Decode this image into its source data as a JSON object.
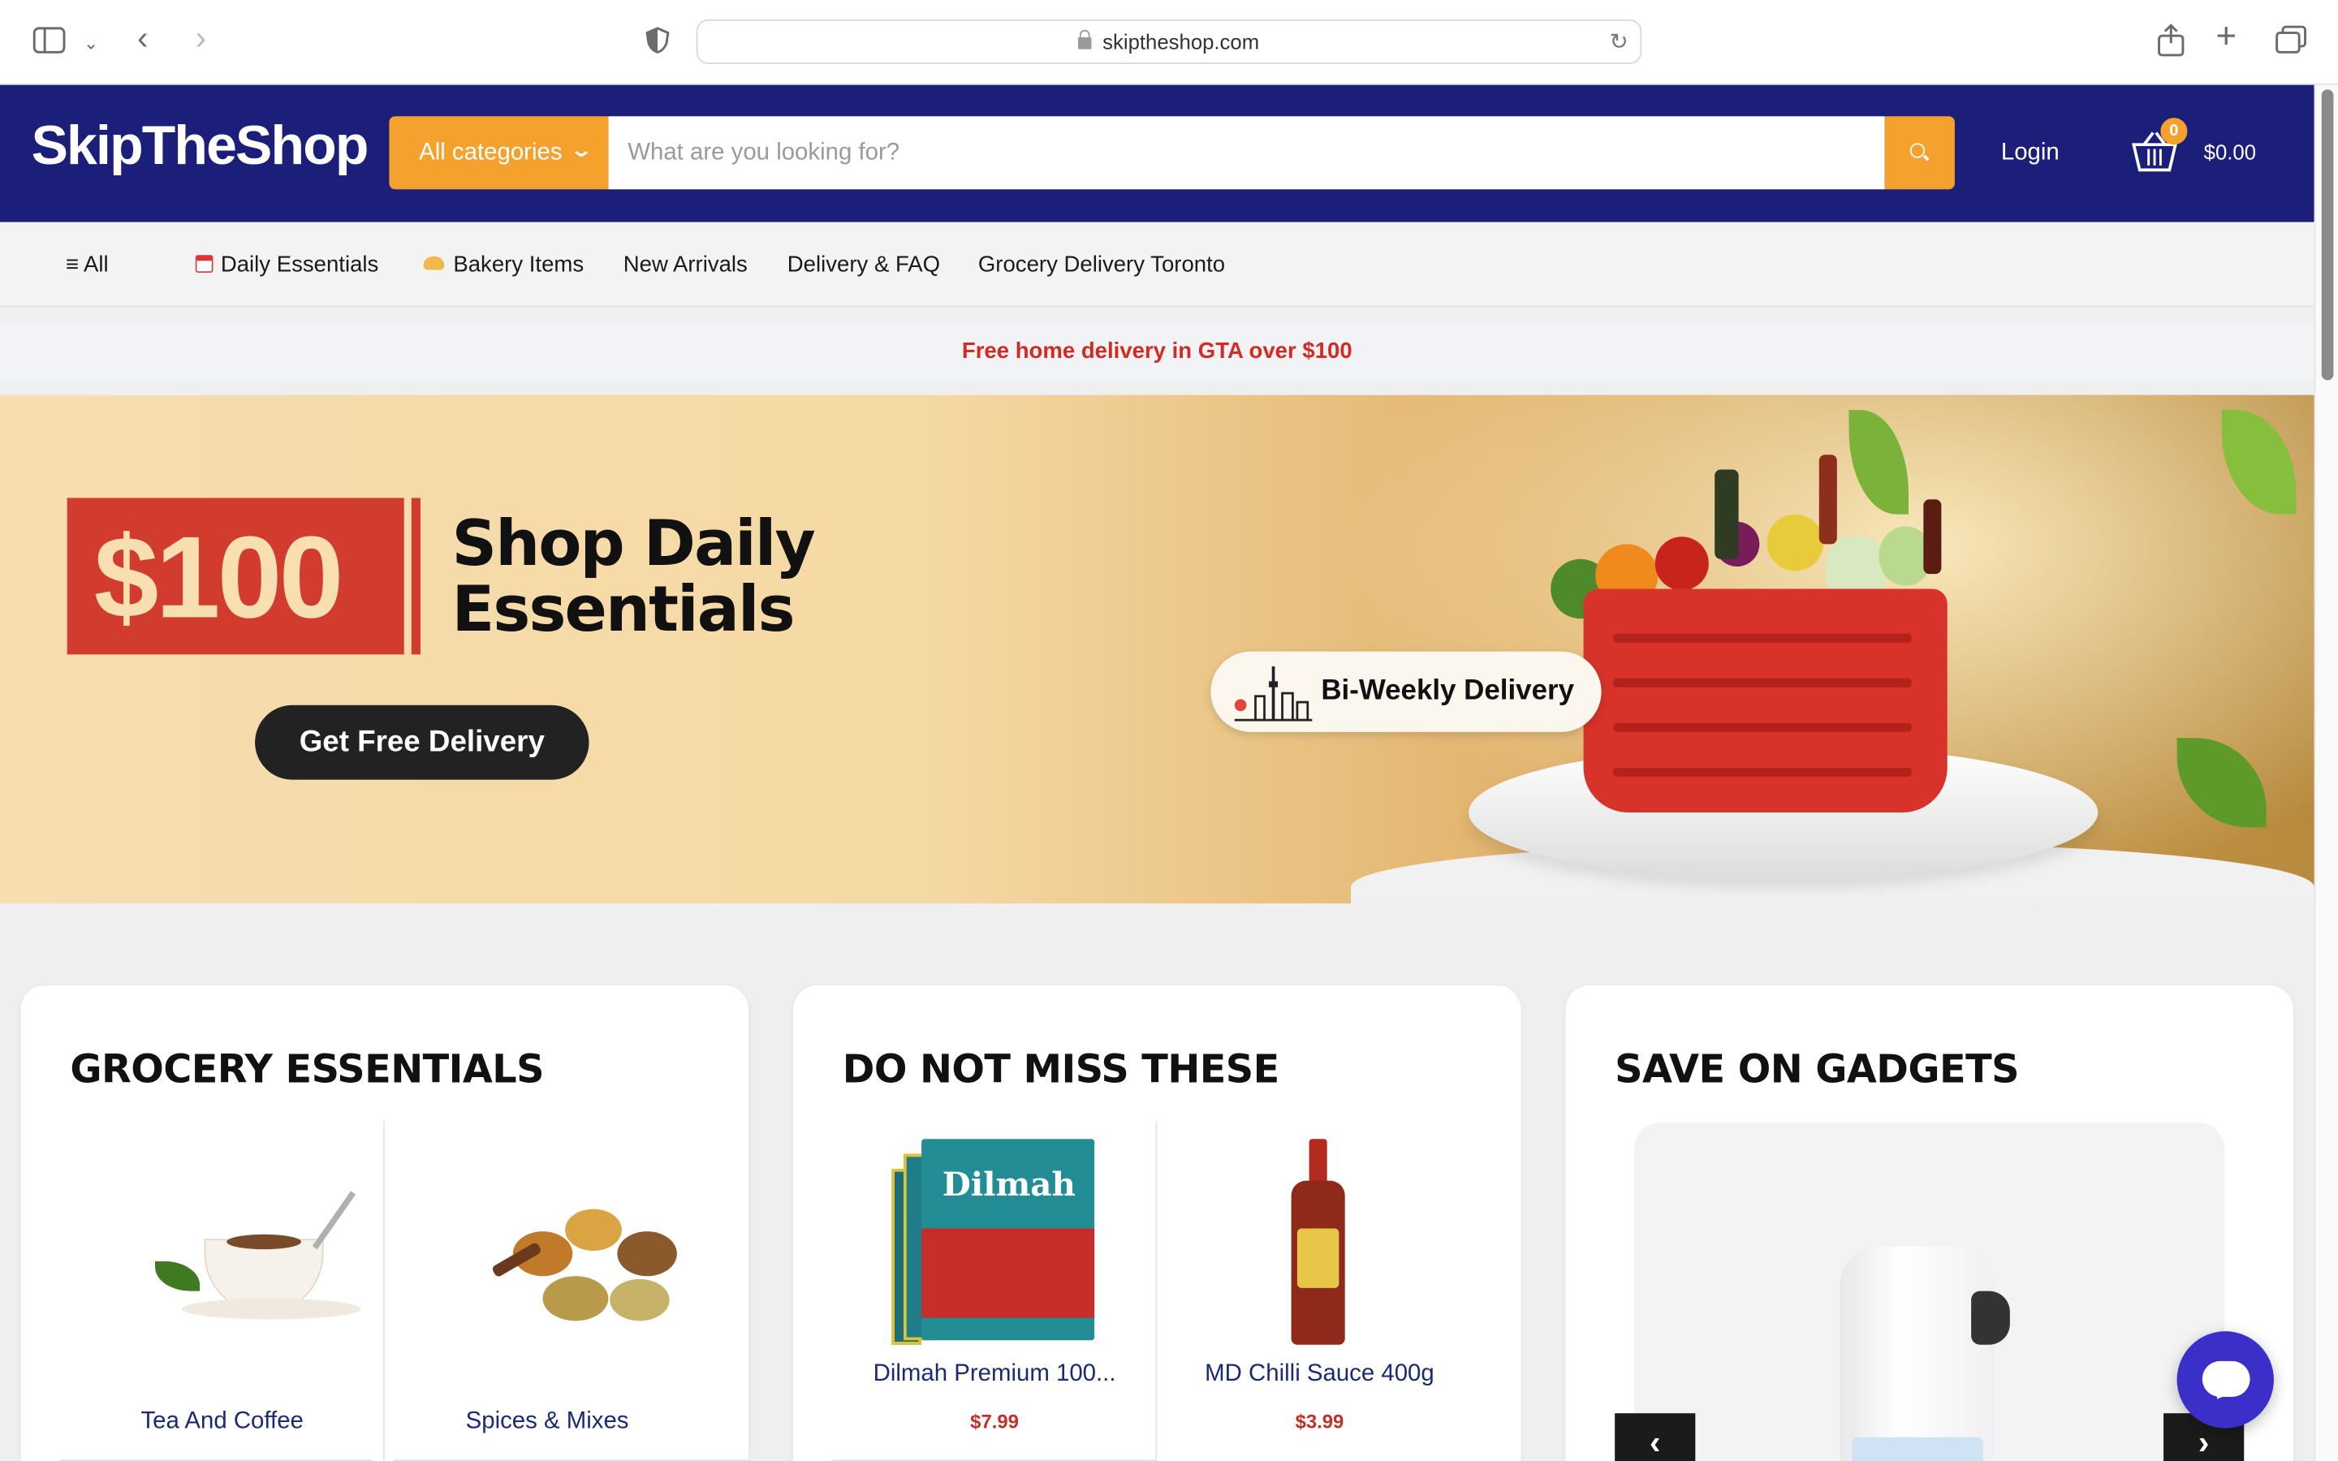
{
  "browser": {
    "url": "skiptheshop.com"
  },
  "header": {
    "logo": "SkipTheShop",
    "category_label": "All categories",
    "search_placeholder": "What are you looking for?",
    "login_label": "Login",
    "cart_count": "0",
    "cart_total": "$0.00"
  },
  "nav": {
    "all_label": "≡ All",
    "items": [
      {
        "label": "Daily Essentials",
        "icon": "calendar-icon"
      },
      {
        "label": "Bakery Items",
        "icon": "bread-icon"
      },
      {
        "label": "New Arrivals"
      },
      {
        "label": "Delivery & FAQ"
      },
      {
        "label": "Grocery Delivery Toronto"
      }
    ]
  },
  "promo_strip": "Free home delivery in GTA over $100",
  "hero": {
    "badge_amount": "$100",
    "title_line1": "Shop Daily",
    "title_line2": "Essentials",
    "cta_label": "Get Free Delivery",
    "delivery_pill": "Bi-Weekly Delivery"
  },
  "cards": [
    {
      "title": "GROCERY ESSENTIALS",
      "items": [
        {
          "label": "Tea And Coffee"
        },
        {
          "label": "Spices & Mixes"
        }
      ]
    },
    {
      "title": "DO NOT MISS THESE",
      "items": [
        {
          "label": "Dilmah Premium 100...",
          "price": "$7.99"
        },
        {
          "label": "MD Chilli Sauce 400g",
          "price": "$3.99"
        }
      ]
    },
    {
      "title": "SAVE ON GADGETS",
      "prev": "‹",
      "next": "›"
    }
  ],
  "colors": {
    "header_bg": "#1b1f7a",
    "accent": "#f4a12d",
    "promo_red": "#d32a22",
    "chat_bg": "#3b2fc9"
  }
}
